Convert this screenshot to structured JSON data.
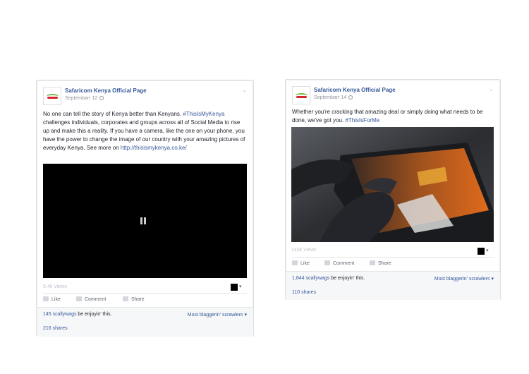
{
  "posts": [
    {
      "page_name": "Safaricom Kenya Official Page",
      "date": "Septembarr 12",
      "text_part1": "No one can tell the story of Kenya better than Kenyans. ",
      "hashtag": "#ThisIsMyKenya",
      "text_part2": " challenges individuals, corporates and groups across all of Social Media to rise up and make this a reality. If you have a camera, like the one on your phone, you have the power to change the image of our country with your amazing pictures of everyday Kenya. See more on ",
      "link": "http://thisismykenya.co.ke/",
      "views": "5.4k Views",
      "like_label": "Like",
      "comment_label": "Comment",
      "share_label": "Share",
      "likes_count": "145 scallywags",
      "likes_suffix": " be enjoyin' this.",
      "most_label": "Most blaggerin' scrawlers ▾",
      "shares": "216 shares"
    },
    {
      "page_name": "Safaricom Kenya Official Page",
      "date": "Septembarr 14",
      "text_part1": "Whether you're cracking that amazing deal or simply doing what needs to be done, we've got you. ",
      "hashtag": "#ThisIsForMe",
      "views": "140k Views",
      "like_label": "Like",
      "comment_label": "Comment",
      "share_label": "Share",
      "likes_count": "1,844 scallywags",
      "likes_suffix": " be enjoyin' this.",
      "most_label": "Most blaggerin' scrawlers ▾",
      "shares": "110 shares"
    }
  ],
  "icons": [
    "safaricom-logo-icon",
    "globe-icon",
    "chevron-down-icon",
    "like-icon",
    "comment-icon",
    "share-icon",
    "pause-icon",
    "dropdown-arrow-icon"
  ]
}
